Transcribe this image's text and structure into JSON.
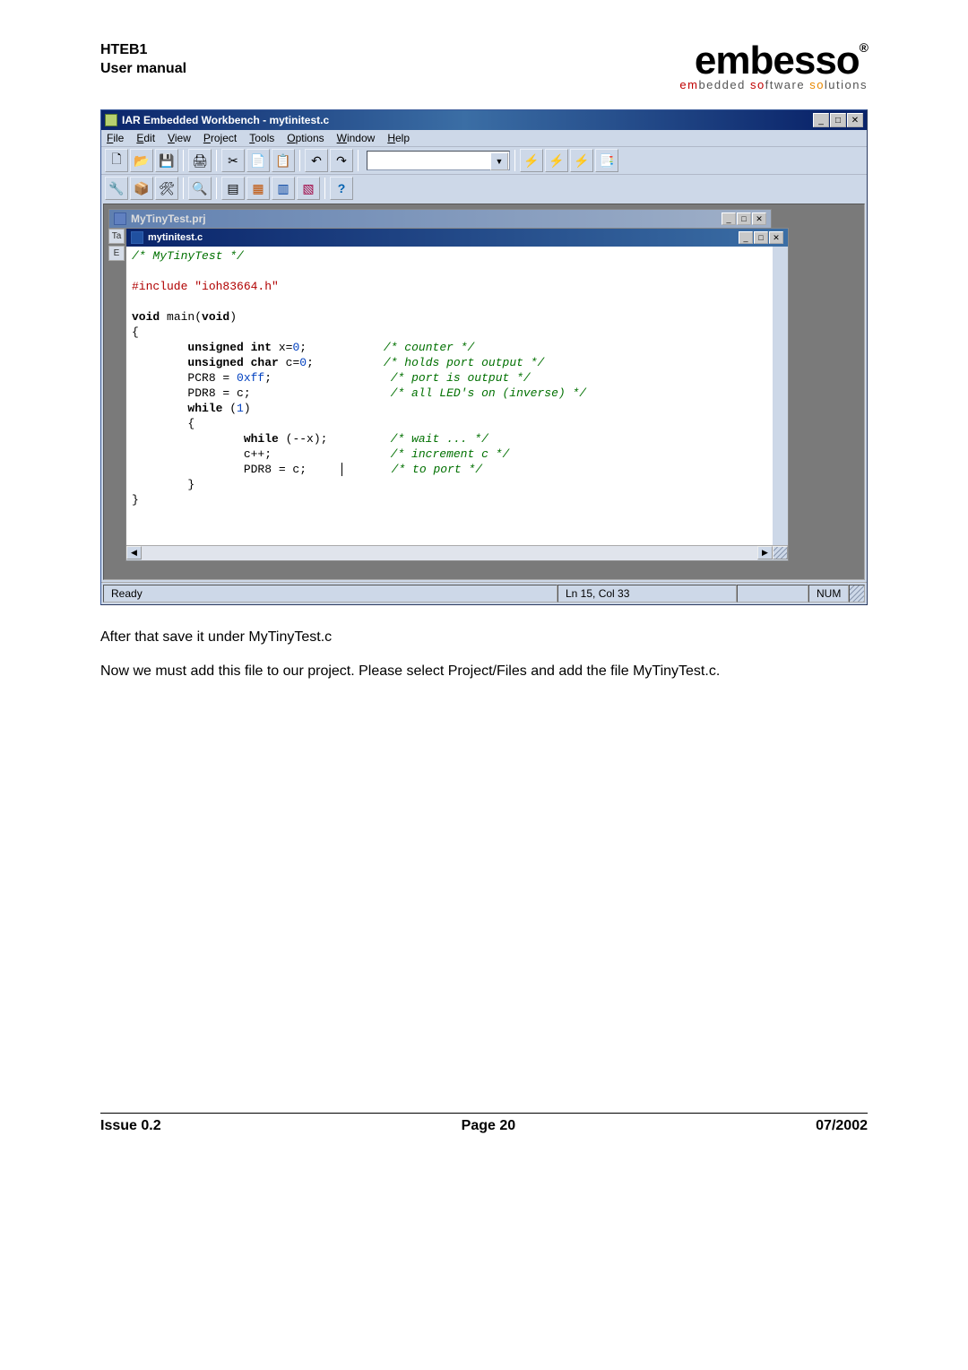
{
  "header": {
    "product": "HTEB1",
    "subtitle": "User manual",
    "logo_main": "embesso",
    "logo_sub_em": "em",
    "logo_sub_bedded": "bedded ",
    "logo_sub_so": "so",
    "logo_sub_ftware": "ftware ",
    "logo_sub_so2": "so",
    "logo_sub_lutions": "lutions"
  },
  "ide": {
    "title": "IAR Embedded Workbench - mytinitest.c",
    "menus": {
      "file": "File",
      "edit": "Edit",
      "view": "View",
      "project": "Project",
      "tools": "Tools",
      "options": "Options",
      "window": "Window",
      "help": "Help"
    },
    "project_title": "MyTinyTest.prj",
    "code_title": "mytinitest.c",
    "status_ready": "Ready",
    "status_pos": "Ln 15, Col 33",
    "status_num": "NUM"
  },
  "code": {
    "l01a": "/* MyTinyTest */",
    "l02": "#include \"ioh83664.h\"",
    "l03a": "void",
    "l03b": " main(",
    "l03c": "void",
    "l03d": ")",
    "l04": "{",
    "l05a": "        ",
    "l05b": "unsigned int",
    "l05c": " x=",
    "l05d": "0",
    "l05e": ";",
    "l05f": "/* counter */",
    "l06b": "unsigned char",
    "l06c": " c=",
    "l06d": "0",
    "l06e": ";",
    "l06f": "/* holds port output */",
    "l07a": "        PCR8 = ",
    "l07b": "0xff",
    "l07c": ";",
    "l07f": "/* port is output */",
    "l08a": "        PDR8 = c;",
    "l08f": "/* all LED's on (inverse) */",
    "l09a": "        ",
    "l09b": "while",
    "l09c": " (",
    "l09d": "1",
    "l09e": ")",
    "l10": "        {",
    "l11a": "                ",
    "l11b": "while",
    "l11c": " (--x);",
    "l11f": "/* wait ... */",
    "l12a": "                c++;",
    "l12f": "/* increment c */",
    "l13a": "                PDR8 = c;     ",
    "l13f": "/* to port */",
    "l14": "        }",
    "l15": "}"
  },
  "body": {
    "p1": "After that save it under MyTinyTest.c",
    "p2": "Now we must add this file to our project. Please select Project/Files and add the file MyTinyTest.c."
  },
  "footer": {
    "issue": "Issue 0.2",
    "page": "Page 20",
    "date": "07/2002"
  }
}
